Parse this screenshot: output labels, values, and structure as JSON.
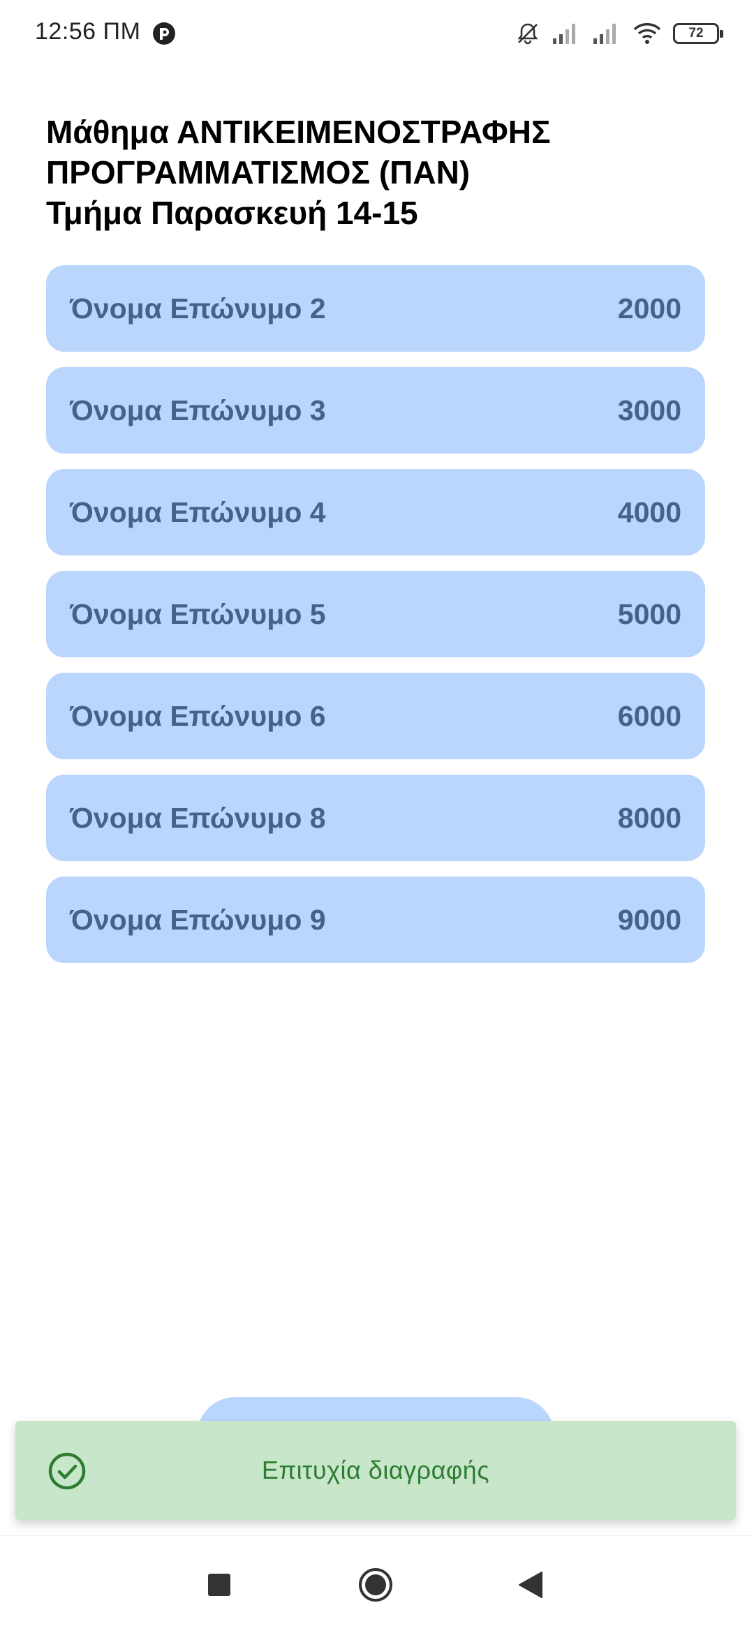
{
  "status_bar": {
    "time": "12:56 ΠΜ",
    "battery": "72"
  },
  "header": {
    "title_line_1": "Μάθημα ΑΝΤΙΚΕΙΜΕΝΟΣΤΡΑΦΗΣ",
    "title_line_2": "ΠΡΟΓΡΑΜΜΑΤΙΣΜΟΣ (ΠΑΝ)",
    "title_line_3": "Τμήμα Παρασκευή 14-15"
  },
  "students": [
    {
      "name": "Όνομα Επώνυμο 2",
      "score": "2000"
    },
    {
      "name": "Όνομα Επώνυμο 3",
      "score": "3000"
    },
    {
      "name": "Όνομα Επώνυμο 4",
      "score": "4000"
    },
    {
      "name": "Όνομα Επώνυμο 5",
      "score": "5000"
    },
    {
      "name": "Όνομα Επώνυμο 6",
      "score": "6000"
    },
    {
      "name": "Όνομα Επώνυμο 8",
      "score": "8000"
    },
    {
      "name": "Όνομα Επώνυμο 9",
      "score": "9000"
    }
  ],
  "toast": {
    "message": "Επιτυχία διαγραφής",
    "icon": "check-circle-icon"
  },
  "nav_bar": {
    "recent_icon": "square-icon",
    "home_icon": "circle-icon",
    "back_icon": "triangle-back-icon"
  },
  "colors": {
    "row_background": "#bbd6fd",
    "row_text": "#45628c",
    "toast_background": "#c8e6c9",
    "toast_text": "#2e7d32"
  }
}
